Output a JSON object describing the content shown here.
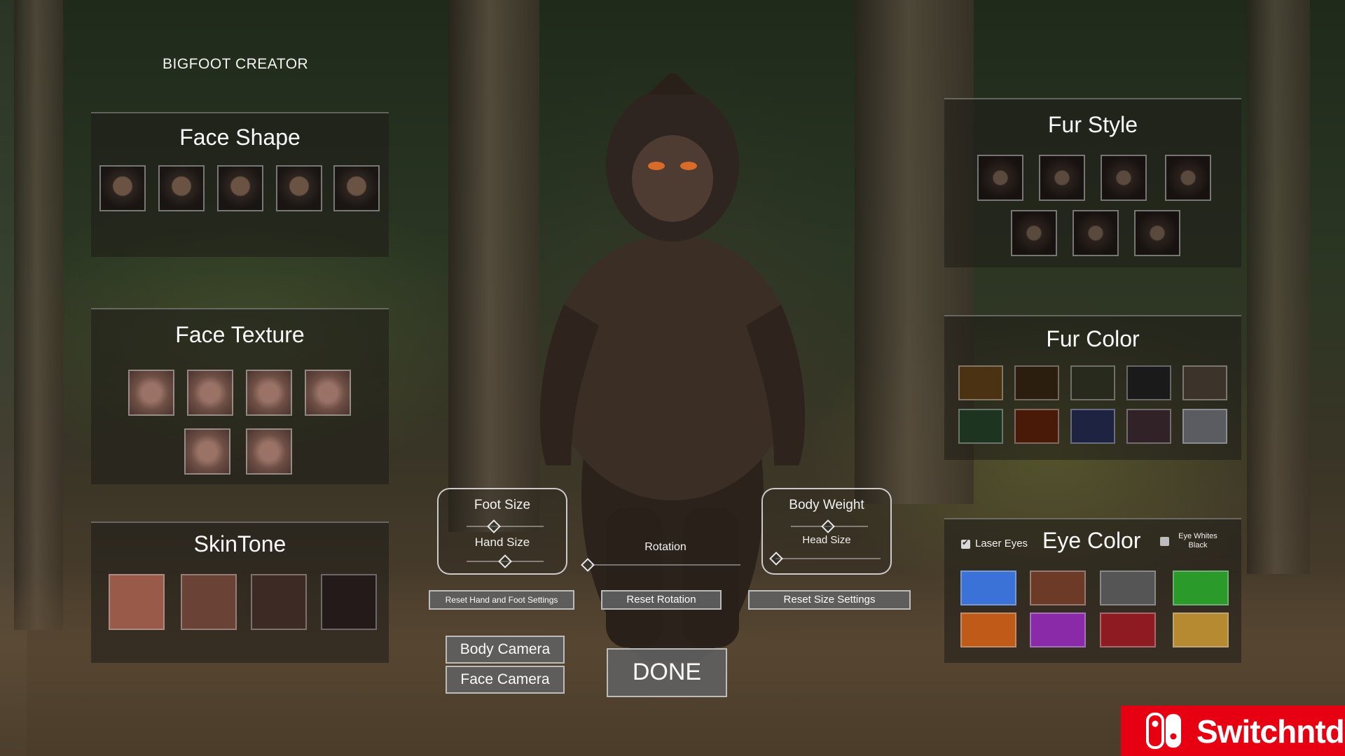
{
  "app_title": "BIGFOOT CREATOR",
  "face_shape": {
    "title": "Face Shape",
    "options": [
      "face-shape-1",
      "face-shape-2",
      "face-shape-3",
      "face-shape-4",
      "face-shape-5"
    ]
  },
  "face_texture": {
    "title": "Face Texture",
    "options": [
      "face-texture-1",
      "face-texture-2",
      "face-texture-3",
      "face-texture-4",
      "face-texture-5",
      "face-texture-6"
    ]
  },
  "skin_tone": {
    "title": "SkinTone",
    "colors": [
      "#9a5a4a",
      "#6b4236",
      "#3e2a24",
      "#241a1a"
    ]
  },
  "fur_style": {
    "title": "Fur Style",
    "options": [
      "fur-style-1",
      "fur-style-2",
      "fur-style-3",
      "fur-style-4",
      "fur-style-5",
      "fur-style-6",
      "fur-style-7"
    ]
  },
  "fur_color": {
    "title": "Fur Color",
    "colors": [
      "#4a3212",
      "#2c1e0e",
      "#272a1d",
      "#1a1a1a",
      "#3c332a",
      "#1c3420",
      "#4a1a08",
      "#1d2340",
      "#302226",
      "#5a5c62"
    ]
  },
  "eye_color": {
    "title": "Eye Color",
    "laser_eyes": {
      "label": "Laser Eyes",
      "checked": true
    },
    "eye_whites_black": {
      "label_line1": "Eye Whites",
      "label_line2": "Black",
      "checked": false
    },
    "colors": [
      "#3b72d8",
      "#6e3a28",
      "#555555",
      "#2a9a2a",
      "#c05a18",
      "#8a2aa8",
      "#8e1a22",
      "#b58a30"
    ]
  },
  "sliders": {
    "foot_size": "Foot Size",
    "hand_size": "Hand Size",
    "rotation": "Rotation",
    "body_weight": "Body Weight",
    "head_size": "Head Size"
  },
  "buttons": {
    "reset_hand_foot": "Reset Hand and Foot Settings",
    "reset_rotation": "Reset Rotation",
    "reset_size": "Reset Size Settings",
    "body_camera": "Body Camera",
    "face_camera": "Face Camera",
    "done": "DONE"
  },
  "watermark": "Switchntd"
}
